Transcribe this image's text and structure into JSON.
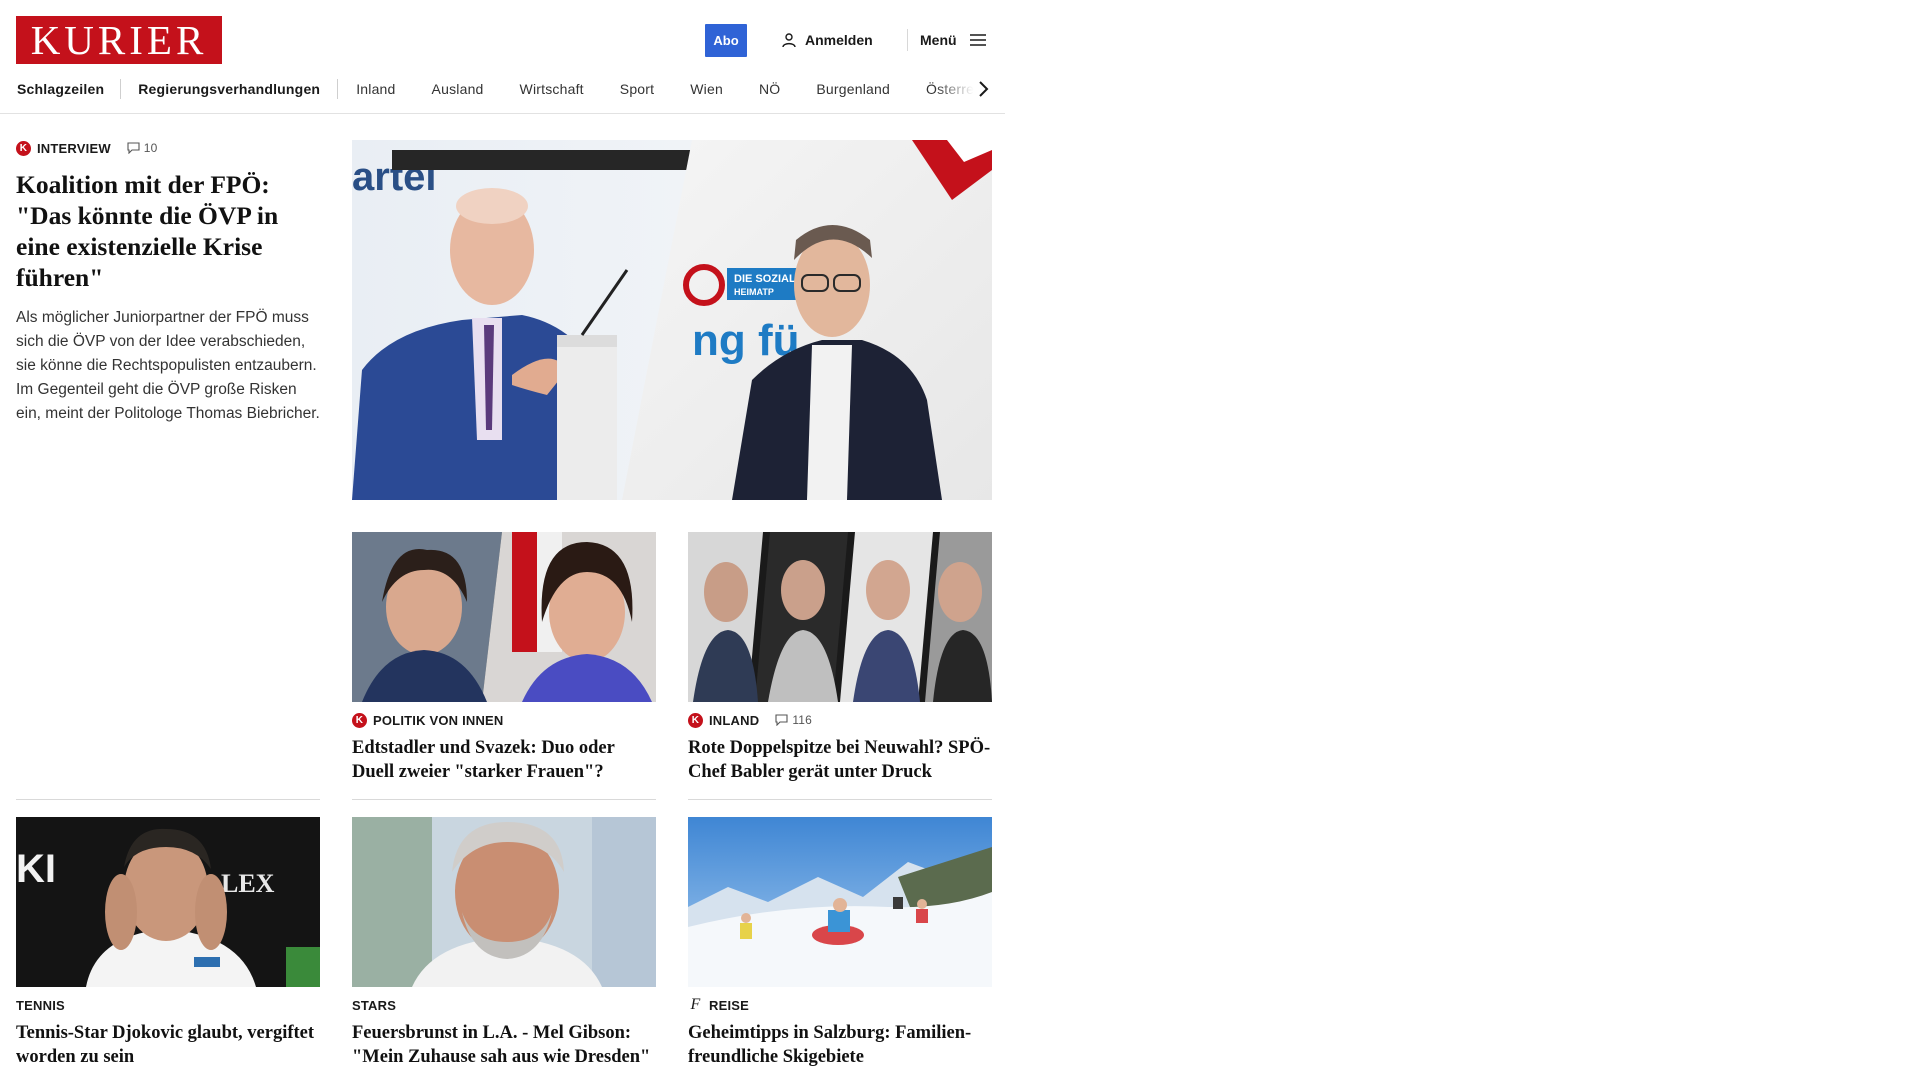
{
  "header": {
    "logo_text": "KURIER",
    "abo_label": "Abo",
    "login_label": "Anmelden",
    "menu_label": "Menü"
  },
  "nav": {
    "items": [
      "Schlagzeilen",
      "Regierungsverhandlungen",
      "Inland",
      "Ausland",
      "Wirtschaft",
      "Sport",
      "Wien",
      "NÖ",
      "Burgenland",
      "Österreich"
    ]
  },
  "lead": {
    "kicker": "INTERVIEW",
    "comments": "10",
    "headline": "Koalition mit der FPÖ: \"Das könnte die ÖVP in eine existenzielle Krise führen\"",
    "teaser": "Als möglicher Juniorpartner der FPÖ muss sich die ÖVP von der Idee verabschieden, sie könne die Rechtspopulisten entzaubern. Im Gegenteil geht die ÖVP große Risken ein, meint der Politologe Thomas Biebricher.",
    "image_text": "artei"
  },
  "articles": [
    {
      "kicker": "POLITIK VON INNEN",
      "headline": "Edtstadler und Svazek: Duo oder Duell zweier \"starker Frauen\"?",
      "comments": "",
      "badge": "k-icon"
    },
    {
      "kicker": "INLAND",
      "headline": "Rote Doppelspitze bei Neuwahl? SPÖ-Chef Babler gerät unter Druck",
      "comments": "116",
      "badge": "k-icon"
    },
    {
      "kicker": "TENNIS",
      "headline": "Tennis-Star Djokovic glaubt, ver­giftet worden zu sein",
      "comments": "",
      "badge": ""
    },
    {
      "kicker": "STARS",
      "headline": "Feuersbrunst in L.A. - Mel Gibson: \"Mein Zuhause sah aus wie Dresden\"",
      "comments": "",
      "badge": ""
    },
    {
      "kicker": "REISE",
      "headline": "Geheimtipps in Salzburg: Familien­freundliche Skigebiete",
      "comments": "",
      "badge": "freizeit-f-icon"
    }
  ],
  "colors": {
    "brand_red": "#c4111b",
    "abo_blue": "#2f63d6"
  },
  "k_badge_letter": "K",
  "f_badge_letter": "f"
}
